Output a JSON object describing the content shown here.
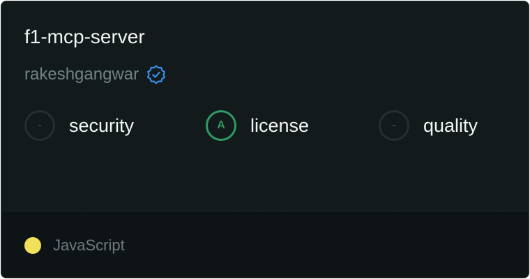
{
  "repo": {
    "name": "f1-mcp-server",
    "owner": "rakeshgangwar",
    "owner_verified": true,
    "verified_icon": "verified-badge-icon",
    "verified_color": "#3b8ce8"
  },
  "scores": [
    {
      "key": "security",
      "grade": "-",
      "label": "security",
      "status": "ungraded"
    },
    {
      "key": "license",
      "grade": "A",
      "label": "license",
      "status": "graded",
      "color": "#2e9b61"
    },
    {
      "key": "quality",
      "grade": "-",
      "label": "quality",
      "status": "ungraded"
    }
  ],
  "footer": {
    "language": "JavaScript",
    "language_color": "#f1e05a"
  },
  "colors": {
    "card_background": "#121a1c",
    "footer_background": "#0e1416",
    "title_text": "#f2f4f5",
    "muted_text": "#6f8482"
  }
}
